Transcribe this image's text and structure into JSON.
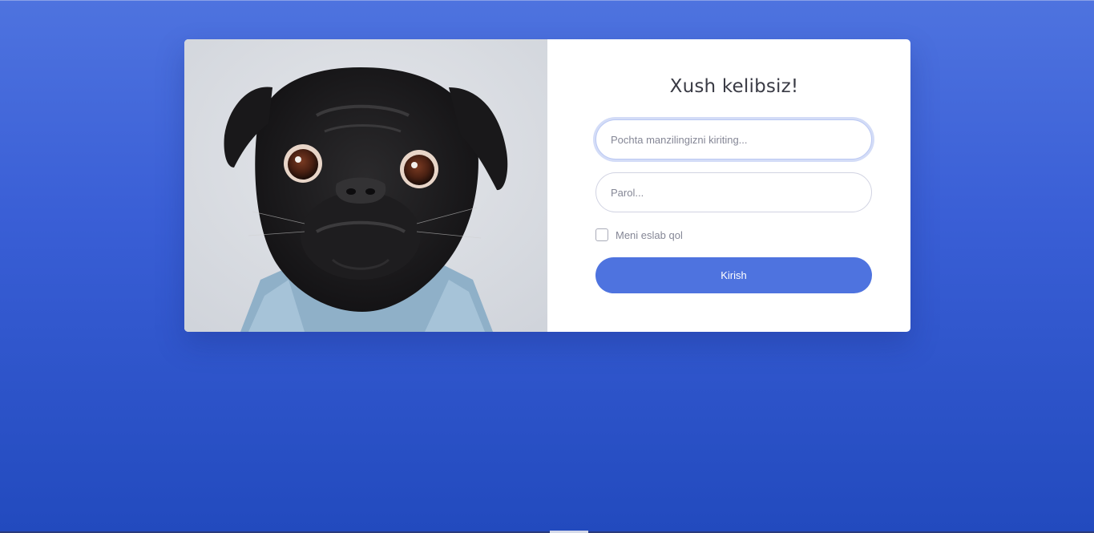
{
  "login": {
    "title": "Xush kelibsiz!",
    "email": {
      "placeholder": "Pochta manzilingizni kiriting...",
      "value": ""
    },
    "password": {
      "placeholder": "Parol...",
      "value": ""
    },
    "remember_label": "Meni eslab qol",
    "remember_checked": false,
    "submit_label": "Kirish"
  },
  "colors": {
    "accent": "#4e73df",
    "background_top": "#4e73df",
    "background_bottom": "#224abe",
    "title_text": "#3a3b45",
    "muted_text": "#858796"
  },
  "image": {
    "subject": "pug-dog-photo"
  }
}
